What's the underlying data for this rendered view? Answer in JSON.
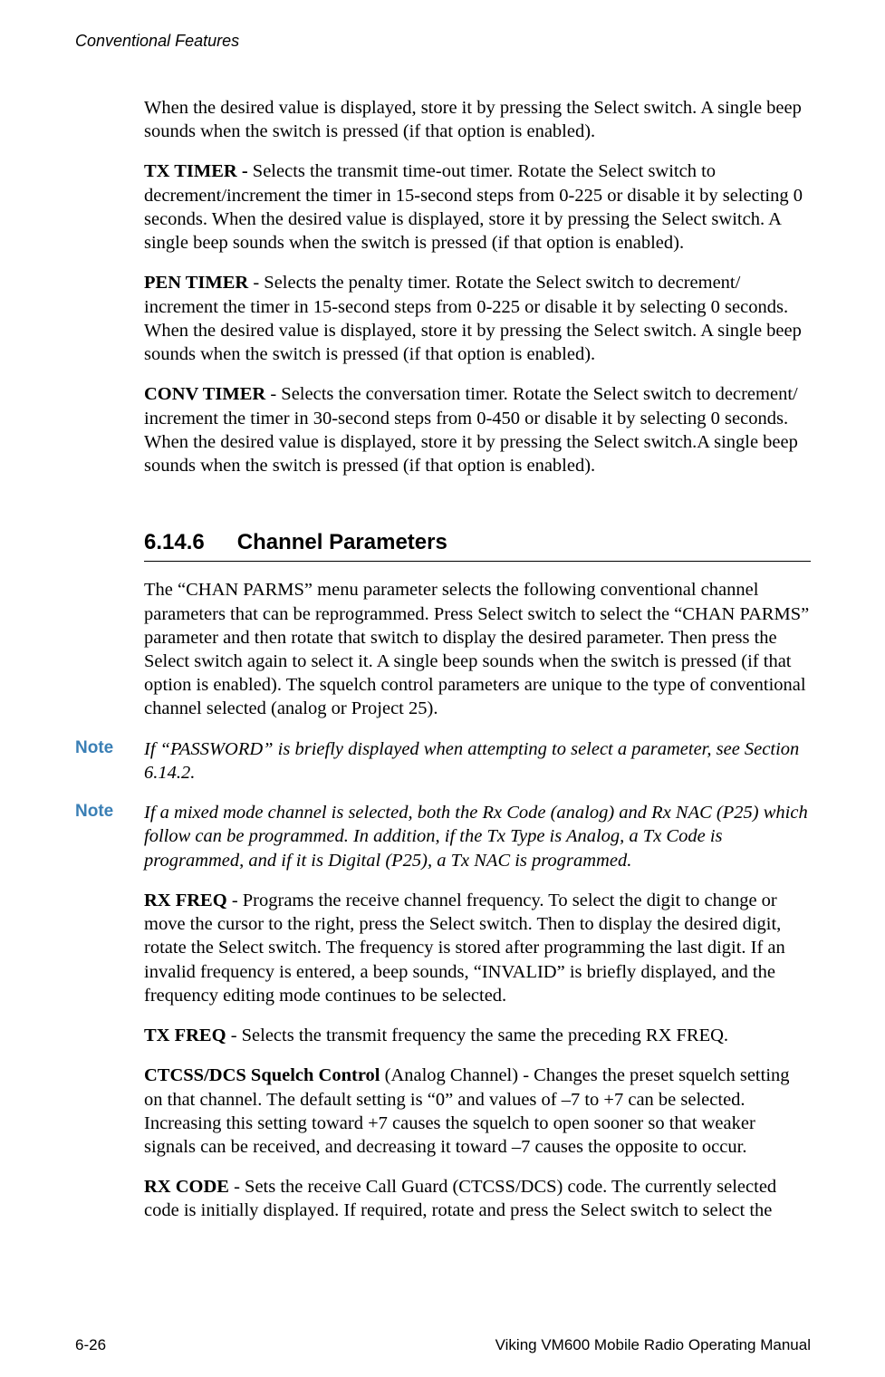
{
  "header": {
    "running_head": "Conventional Features"
  },
  "content": {
    "p_intro": "When the desired value is displayed, store it by pressing the Select switch. A single beep sounds when the switch is pressed (if that option is enabled).",
    "tx_timer_label": "TX TIMER - ",
    "tx_timer_text": "Selects the transmit time-out timer. Rotate the Select switch to decrement/increment the timer in 15-second steps from 0-225 or disable it by selecting 0 seconds. When the desired value is displayed, store it by pressing the Select switch. A single beep sounds when the switch is pressed (if that option is enabled).",
    "pen_timer_label": "PEN TIMER",
    "pen_timer_text": " - Selects the penalty timer. Rotate the Select switch to decrement/ increment the timer in 15-second steps from 0-225 or disable it by selecting 0 seconds. When the desired value is displayed, store it by pressing the Select switch. A single beep sounds when the switch is pressed (if that option is enabled).",
    "conv_timer_label": "CONV TIMER",
    "conv_timer_text": " - Selects the conversation timer. Rotate the Select switch to decrement/ increment the timer in 30-second steps from 0-450 or disable it by selecting 0 seconds. When the desired value is displayed, store it by pressing the Select switch.A single beep sounds when the switch is pressed (if that option is enabled).",
    "heading_num": "6.14.6",
    "heading_title": "Channel Parameters",
    "p_chan_parms": "The “CHAN PARMS” menu parameter selects the following conventional channel parameters that can be reprogrammed. Press Select switch to select the “CHAN PARMS” parameter and then rotate that switch to display the desired parameter. Then press the Select switch again to select it. A single beep sounds when the switch is pressed (if that option is enabled). The squelch control parameters are unique to the type of conventional channel selected (analog or Project 25).",
    "note_label": "Note",
    "note1_text": "If “PASSWORD” is briefly displayed when attempting to select a parameter, see Section 6.14.2.",
    "note2_text": "If a mixed mode channel is selected, both the Rx Code (analog) and Rx NAC (P25) which follow can be programmed. In addition, if the Tx Type is Analog, a Tx Code is programmed, and if it is Digital (P25), a Tx NAC is programmed.",
    "rx_freq_label": "RX FREQ",
    "rx_freq_text": " - Programs the receive channel frequency. To select the digit to change or move the cursor to the right, press the Select switch. Then to display the desired digit, rotate the Select switch. The frequency is stored after programming the last digit. If an invalid frequency is entered, a beep sounds, “INVALID” is briefly displayed, and the frequency editing mode continues to be selected.",
    "tx_freq_label": "TX FREQ",
    "tx_freq_text": " - Selects the transmit frequency the same the preceding RX FREQ.",
    "ctcss_label": "CTCSS/DCS Squelch Control",
    "ctcss_text": " (Analog Channel) - Changes the preset squelch setting on that channel. The default setting is “0” and values of –7 to +7 can be selected. Increasing this setting toward +7 causes the squelch to open sooner so that weaker signals can be received, and decreasing it toward –7 causes the opposite to occur.",
    "rx_code_label": "RX CODE",
    "rx_code_text": " - Sets the receive Call Guard (CTCSS/DCS) code. The currently selected code is initially displayed. If required, rotate and press the Select switch to select the"
  },
  "footer": {
    "page_number": "6-26",
    "doc_title": "Viking VM600 Mobile Radio Operating Manual"
  }
}
